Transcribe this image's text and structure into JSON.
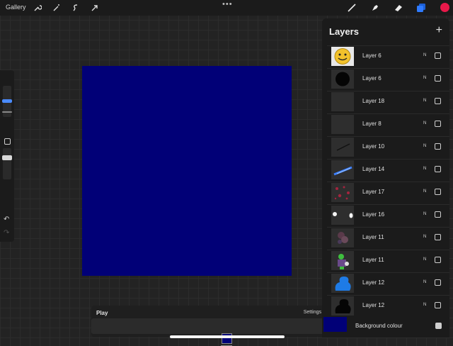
{
  "toolbar": {
    "gallery_label": "Gallery",
    "actions_icons": [
      "wrench-icon",
      "magic-wand-icon",
      "selection-icon",
      "transform-arrow-icon"
    ],
    "menu_dots": "•••",
    "right_tools": [
      "brush-icon",
      "smudge-icon",
      "eraser-icon",
      "layers-icon"
    ],
    "current_color": "#e8194a"
  },
  "canvas": {
    "fill_color": "#010077"
  },
  "animation": {
    "play_label": "Play",
    "settings_label": "Settings",
    "frame_color": "#010077"
  },
  "layers_panel": {
    "title": "Layers",
    "add_label": "+",
    "layers": [
      {
        "name": "Layer 6",
        "blend": "N",
        "visible": false,
        "thumb": "smiley"
      },
      {
        "name": "Layer 6",
        "blend": "N",
        "visible": false,
        "thumb": "black-circle"
      },
      {
        "name": "Layer 18",
        "blend": "N",
        "visible": false,
        "thumb": "empty"
      },
      {
        "name": "Layer 8",
        "blend": "N",
        "visible": false,
        "thumb": "empty"
      },
      {
        "name": "Layer 10",
        "blend": "N",
        "visible": false,
        "thumb": "stroke-dark"
      },
      {
        "name": "Layer 14",
        "blend": "N",
        "visible": false,
        "thumb": "stroke-blue"
      },
      {
        "name": "Layer 17",
        "blend": "N",
        "visible": false,
        "thumb": "red-speckles"
      },
      {
        "name": "Layer 16",
        "blend": "N",
        "visible": false,
        "thumb": "white-dots"
      },
      {
        "name": "Layer 11",
        "blend": "N",
        "visible": false,
        "thumb": "texture"
      },
      {
        "name": "Layer 11",
        "blend": "N",
        "visible": false,
        "thumb": "character"
      },
      {
        "name": "Layer 12",
        "blend": "N",
        "visible": false,
        "thumb": "blue-silhouette"
      },
      {
        "name": "Layer 12",
        "blend": "N",
        "visible": false,
        "thumb": "black-silhouette"
      }
    ],
    "background": {
      "label": "Background colour",
      "visible": true,
      "color": "#010077"
    }
  }
}
